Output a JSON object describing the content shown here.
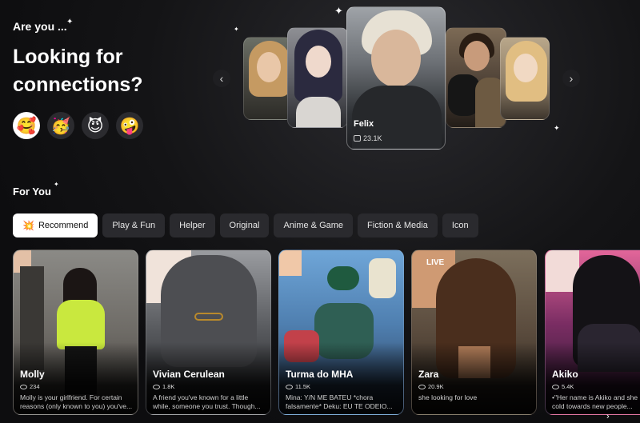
{
  "hero": {
    "kicker": "Are you ...",
    "title": "Looking for connections?",
    "emojis": [
      {
        "glyph": "🥰",
        "name": "smiling-hearts"
      },
      {
        "glyph": "🥳",
        "name": "party"
      },
      {
        "glyph": "😈",
        "name": "devil"
      },
      {
        "glyph": "🤪",
        "name": "zany"
      }
    ]
  },
  "carousel": {
    "prev": "‹",
    "next": "›",
    "featured": {
      "name": "Felix",
      "count": "23.1K"
    }
  },
  "for_you": {
    "title": "For You",
    "tabs": [
      "Recommend",
      "Play & Fun",
      "Helper",
      "Original",
      "Anime & Game",
      "Fiction & Media",
      "Icon"
    ]
  },
  "cards": [
    {
      "name": "Molly",
      "count": "234",
      "desc": "Molly is your girlfriend. For certain reasons (only known to you) you've..."
    },
    {
      "name": "Vivian Cerulean",
      "count": "1.8K",
      "desc": "A friend you've known for a little while, someone you trust. Though..."
    },
    {
      "name": "Turma do MHA",
      "count": "11.5K",
      "desc": "Mina: Y/N ME BATEU *chora falsamente* Deku: EU TE ODEIO..."
    },
    {
      "name": "Zara",
      "count": "20.9K",
      "desc": "she looking for love",
      "badge": "LIVE"
    },
    {
      "name": "Akiko",
      "count": "5.4K",
      "desc": "•\"Her name is Akiko and she is cold towards new people..."
    }
  ],
  "more": "›"
}
